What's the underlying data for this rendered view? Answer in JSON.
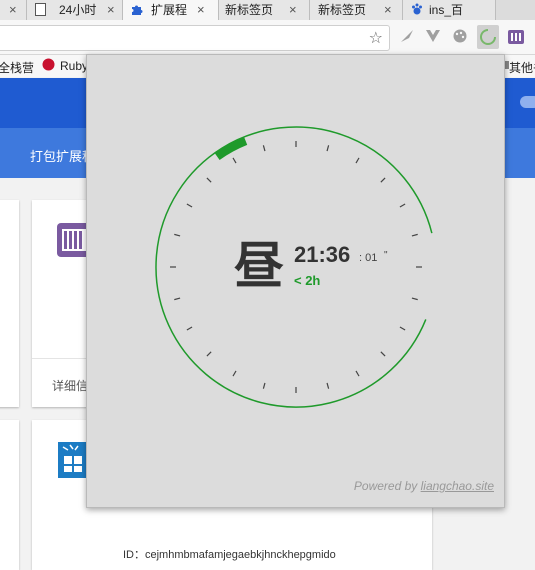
{
  "tabs": [
    {
      "label": "",
      "active": false
    },
    {
      "label": "24小时",
      "active": false
    },
    {
      "label": "扩展程",
      "active": true
    },
    {
      "label": "新标签页",
      "active": false
    },
    {
      "label": "新标签页",
      "active": false
    },
    {
      "label": "ins_百",
      "active": false
    }
  ],
  "tab_close": "×",
  "toolbar": {
    "bookmark_star": "☆",
    "extensions": [
      "feather-icon",
      "vuejs-icon",
      "palette-icon",
      "clock-extension-icon",
      "bars-extension-icon"
    ]
  },
  "bookmarks": {
    "items": [
      "全栈营",
      "Ruby"
    ],
    "other": "其他书"
  },
  "page": {
    "pack_button": "打包扩展程",
    "card_details_label": "详细信",
    "extension_id": "ID：cejmhmbmafamjegaebkjhnckhepgmido"
  },
  "popup": {
    "period": "昼",
    "time": "21:36",
    "seconds": ": 01",
    "seconds_unit": "\"",
    "remaining": "< 2h",
    "powered_prefix": "Powered by ",
    "powered_link": "liangchao.site",
    "arc_color": "#1f9a2b",
    "arc_progress": 0.9
  }
}
